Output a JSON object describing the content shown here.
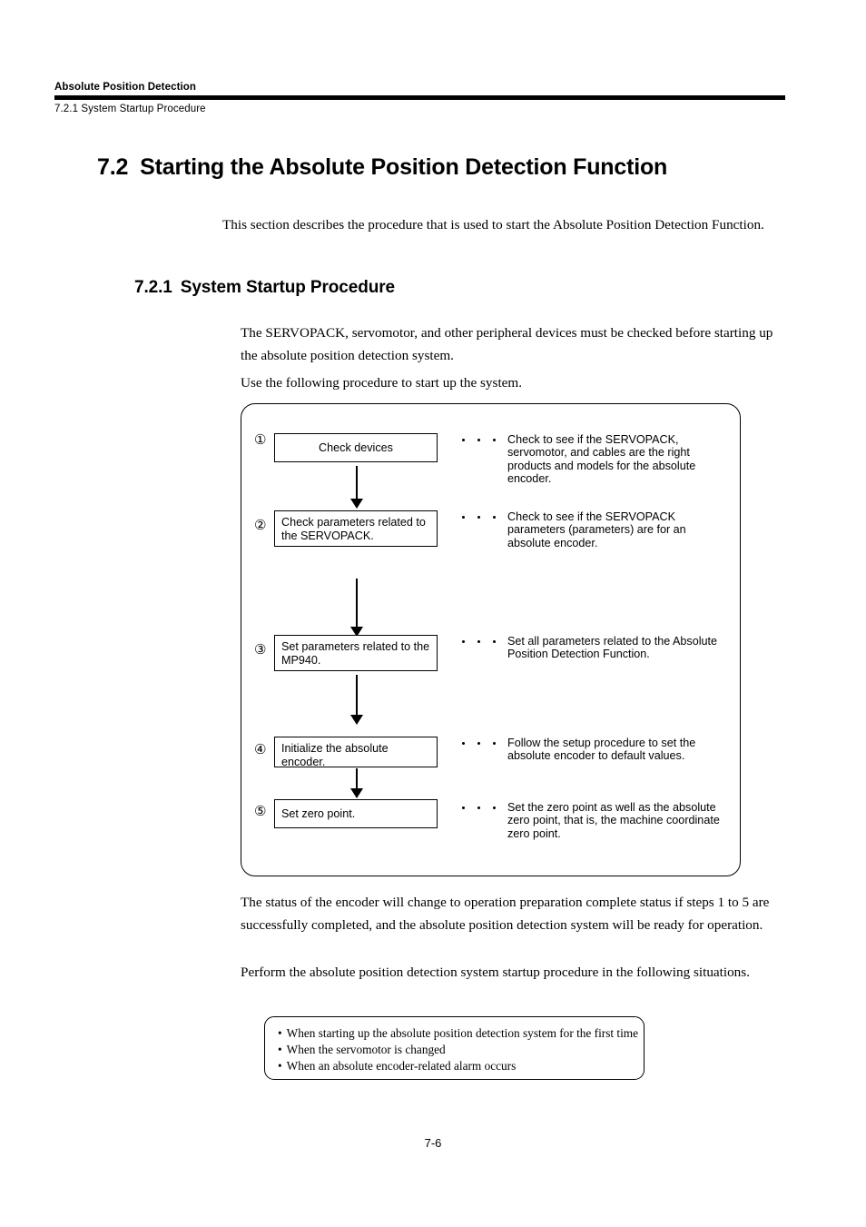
{
  "header": {
    "title": "Absolute Position Detection",
    "subsection": "7.2.1  System Startup Procedure"
  },
  "section": {
    "number": "7.2",
    "title": "Starting the Absolute Position Detection Function"
  },
  "subsection": {
    "number": "7.2.1",
    "title": "System Startup Procedure"
  },
  "paragraphs": {
    "intro": "This section describes the procedure that is used to start the Absolute Position Detection Function.",
    "body1": "The SERVOPACK, servomotor, and other peripheral devices must be checked before starting up the absolute position detection system.",
    "body2": "Use the following procedure to start up the system.",
    "after1": "The status of the encoder will change to operation preparation complete status if steps 1 to 5 are successfully completed, and the absolute position detection system will be ready for operation.",
    "after2": "Perform the absolute position detection system startup procedure in the following situations."
  },
  "flowchart": {
    "steps": [
      {
        "marker": "①",
        "box_text": "Check devices",
        "description": "Check to see if the SERVOPACK, servomotor, and cables are the right products and models for the absolute encoder."
      },
      {
        "marker": "②",
        "box_text": "Check parameters related to the SERVOPACK.",
        "description": "Check to see if the SERVOPACK parameters (parameters) are for an absolute encoder."
      },
      {
        "marker": "③",
        "box_text": "Set parameters related to the MP940.",
        "description": "Set all parameters related to the Absolute Position Detection Function."
      },
      {
        "marker": "④",
        "box_text": "Initialize the absolute encoder.",
        "description": "Follow the setup procedure to set the absolute encoder to default values."
      },
      {
        "marker": "⑤",
        "box_text": "Set zero point.",
        "description": "Set the zero point as well as the absolute zero point, that is, the machine coordinate zero point."
      }
    ]
  },
  "note_box": {
    "bullet": "•",
    "items": [
      "When starting up the absolute position detection system for the first time",
      "When the servomotor is changed",
      "When an absolute encoder-related alarm occurs"
    ]
  },
  "footer": {
    "page_number": "7-6"
  }
}
